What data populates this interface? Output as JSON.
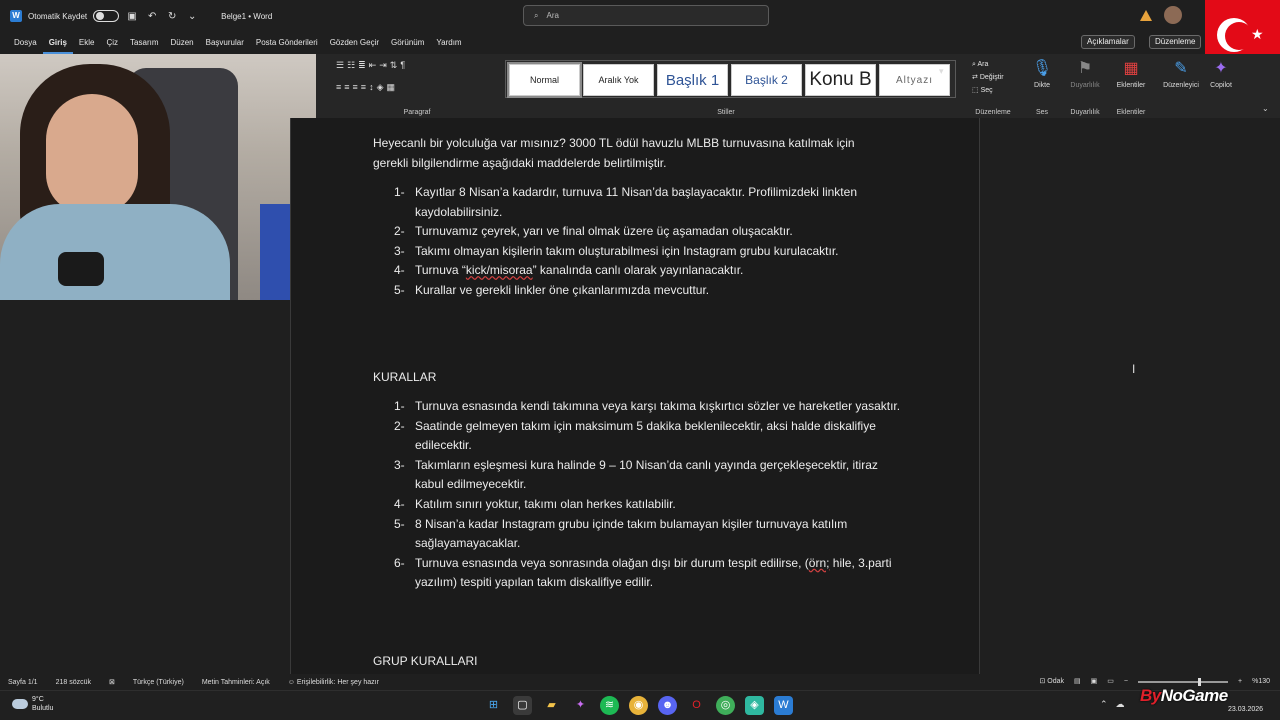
{
  "titlebar": {
    "autosave_label": "Otomatik Kaydet",
    "doc_title": "Belge1 • Word",
    "search_placeholder": "Ara"
  },
  "menu": {
    "tabs": [
      "Dosya",
      "Giriş",
      "Ekle",
      "Çiz",
      "Tasarım",
      "Düzen",
      "Başvurular",
      "Posta Gönderileri",
      "Gözden Geçir",
      "Görünüm",
      "Yardım"
    ],
    "active": "Giriş",
    "comments_label": "Açıklamalar",
    "editing_label": "Düzenleme"
  },
  "ribbon": {
    "paragraph_label": "Paragraf",
    "styles_label": "Stiller",
    "styles": [
      "Normal",
      "Aralık Yok",
      "Başlık 1",
      "Başlık 2",
      "Konu B",
      "Altyazı"
    ],
    "editing": {
      "find": "Ara",
      "replace": "Değiştir",
      "select": "Seç",
      "group": "Düzenleme"
    },
    "voice": {
      "dictate": "Dikte",
      "group": "Ses"
    },
    "sensitivity": {
      "label": "Duyarlılık",
      "group": "Duyarlılık"
    },
    "addins": {
      "label": "Eklentiler",
      "group": "Eklentiler"
    },
    "editor_label": "Düzenleyici",
    "copilot_label": "Copilot"
  },
  "document": {
    "intro": "Heyecanlı bir yolculuğa var mısınız? 3000 TL ödül havuzlu MLBB turnuvasına katılmak için gerekli bilgilendirme aşağıdaki maddelerde belirtilmiştir.",
    "list1": [
      {
        "num": "1-",
        "text": "Kayıtlar 8 Nisan’a kadardır, turnuva 11 Nisan’da başlayacaktır. Profilimizdeki linkten kaydolabilirsiniz."
      },
      {
        "num": "2-",
        "text": "Turnuvamız çeyrek, yarı ve final olmak üzere üç aşamadan oluşacaktır."
      },
      {
        "num": "3-",
        "text": "Takımı olmayan kişilerin takım oluşturabilmesi için Instagram grubu kurulacaktır."
      },
      {
        "num": "4-",
        "text_before": "Turnuva “",
        "text_underlined": "kick/misoraa",
        "text_after": "” kanalında canlı olarak yayınlanacaktır."
      },
      {
        "num": "5-",
        "text": "Kurallar ve gerekli linkler öne çıkanlarımızda mevcuttur."
      }
    ],
    "heading_rules": "KURALLAR",
    "list2": [
      {
        "num": "1-",
        "text": "Turnuva esnasında kendi takımına veya karşı takıma kışkırtıcı sözler ve hareketler yasaktır."
      },
      {
        "num": "2-",
        "text": "Saatinde gelmeyen takım için maksimum 5 dakika beklenilecektir, aksi halde diskalifiye edilecektir."
      },
      {
        "num": "3-",
        "text": "Takımların eşleşmesi kura halinde 9 – 10 Nisan’da canlı yayında gerçekleşecektir, itiraz kabul edilmeyecektir."
      },
      {
        "num": "4-",
        "text": "Katılım sınırı yoktur, takımı olan herkes katılabilir."
      },
      {
        "num": "5-",
        "text": "8 Nisan’a kadar Instagram grubu içinde takım bulamayan kişiler turnuvaya katılım sağlayamayacaklar."
      },
      {
        "num": "6-",
        "text_before": "Turnuva esnasında veya sonrasında olağan dışı bir durum tespit edilirse, (",
        "text_underlined": "örn;",
        "text_after": " hile, 3.parti yazılım) tespiti yapılan takım diskalifiye edilir."
      }
    ],
    "heading_group": "GRUP KURALLARI"
  },
  "status": {
    "page": "Sayfa 1/1",
    "words": "218 sözcük",
    "language": "Türkçe (Türkiye)",
    "prediction": "Metin Tahminleri: Açık",
    "accessibility": "Erişilebilirlik: Her şey hazır",
    "focus": "Odak",
    "zoom": "%130"
  },
  "taskbar": {
    "temp": "9°C",
    "weather": "Bulutlu",
    "date": "23.03.2026"
  },
  "watermark": {
    "left": "By",
    "right": "NoGame"
  },
  "colors": {
    "accent": "#2b7cd3",
    "flag": "#e30a17",
    "spell": "#d04040"
  }
}
